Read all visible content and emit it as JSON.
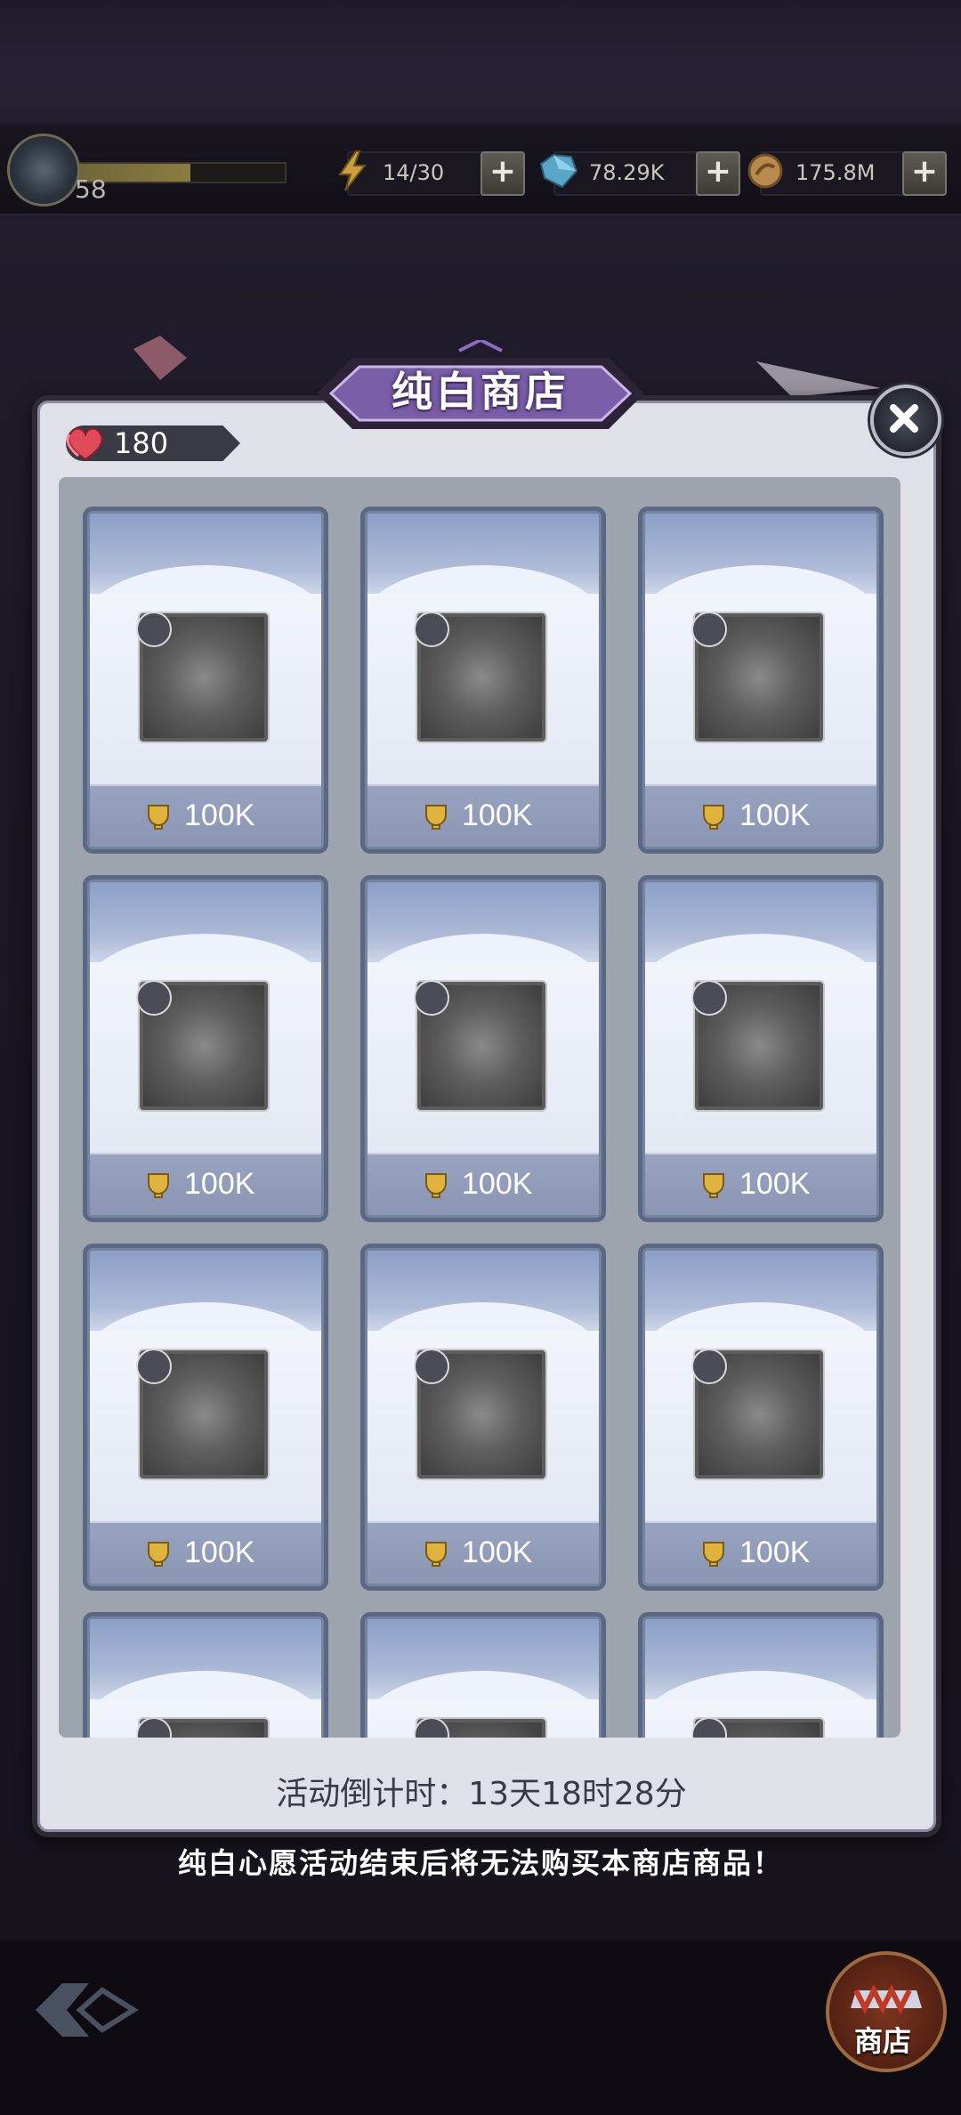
{
  "hud": {
    "level": "58",
    "xp_progress": 0.55,
    "energy": "14/30",
    "gems": "78.29K",
    "coins": "175.8M"
  },
  "shop": {
    "title": "纯白商店",
    "hearts": "180",
    "items": [
      {
        "price": "100K"
      },
      {
        "price": "100K"
      },
      {
        "price": "100K"
      },
      {
        "price": "100K"
      },
      {
        "price": "100K"
      },
      {
        "price": "100K"
      },
      {
        "price": "100K"
      },
      {
        "price": "100K"
      },
      {
        "price": "100K"
      },
      {
        "price": ""
      },
      {
        "price": ""
      },
      {
        "price": ""
      }
    ],
    "countdown": "活动倒计时：13天18时28分",
    "notice": "纯白心愿活动结束后将无法购买本商店商品！"
  },
  "nav": {
    "shop_label": "商店"
  },
  "colors": {
    "modal_bg": "#dfe0e8",
    "title_purple": "#6a4f95",
    "card_border": "#76839c"
  }
}
